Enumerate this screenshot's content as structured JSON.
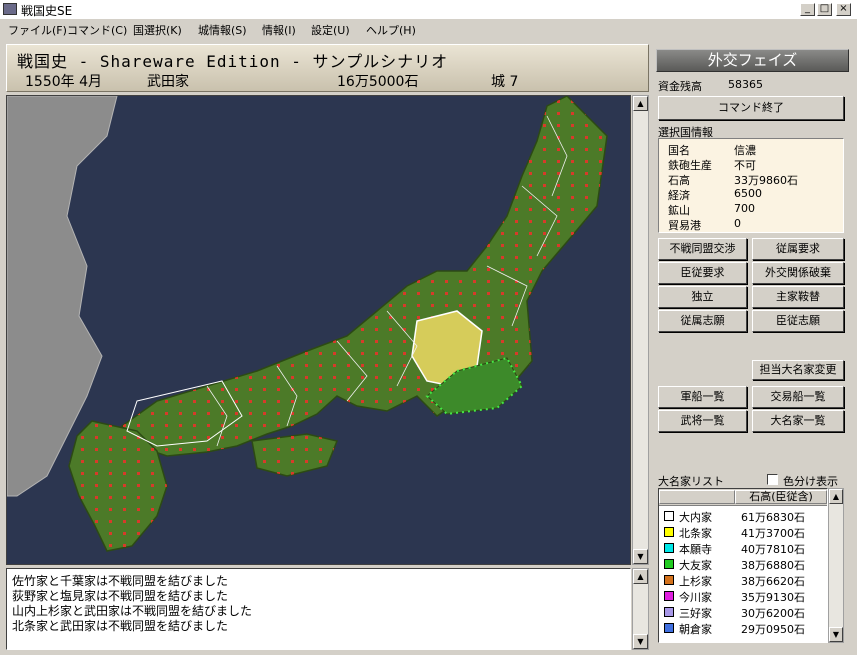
{
  "window": {
    "title": "戦国史SE",
    "minimize": "_",
    "maximize": "□",
    "close": "×"
  },
  "menu": [
    "ファイル(F)",
    "コマンド(C)",
    "国選択(K)",
    "城情報(S)",
    "情報(I)",
    "設定(U)",
    "ヘルプ(H)"
  ],
  "header": {
    "title": "戦国史 - Shareware Edition - サンプルシナリオ",
    "date": "1550年 4月",
    "clan": "武田家",
    "kokudaka": "16万5000石",
    "castles": "城 7"
  },
  "log": [
    "佐竹家と千葉家は不戦同盟を結びました",
    "荻野家と塩見家は不戦同盟を結びました",
    "山内上杉家と武田家は不戦同盟を結びました",
    "北条家と武田家は不戦同盟を結びました"
  ],
  "panel": {
    "phase": "外交フェイズ",
    "funds_label": "資金残高",
    "funds_value": "58365",
    "end_command": "コマンド終了",
    "selected_label": "選択国情報",
    "province": [
      {
        "label": "国名",
        "value": "信濃"
      },
      {
        "label": "鉄砲生産",
        "value": "不可"
      },
      {
        "label": "石高",
        "value": "33万9860石"
      },
      {
        "label": "経済",
        "value": "6500"
      },
      {
        "label": "鉱山",
        "value": "700"
      },
      {
        "label": "貿易港",
        "value": "0"
      }
    ],
    "diplomacy_buttons": [
      "不戦同盟交渉",
      "従属要求",
      "臣従要求",
      "外交関係破棄",
      "独立",
      "主家鞍替",
      "従属志願",
      "臣従志願"
    ],
    "change_daimyo": "担当大名家変更",
    "list_buttons": [
      "軍船一覧",
      "交易船一覧",
      "武将一覧",
      "大名家一覧"
    ],
    "daimyo_list_label": "大名家リスト",
    "color_toggle": "色分け表示",
    "list_column": "石高(臣従含)",
    "daimyo": [
      {
        "name": "大内家",
        "value": "61万6830石",
        "color": "#ffffff"
      },
      {
        "name": "北条家",
        "value": "41万3700石",
        "color": "#ffff00"
      },
      {
        "name": "本願寺",
        "value": "40万7810石",
        "color": "#00e8e8"
      },
      {
        "name": "大友家",
        "value": "38万6880石",
        "color": "#22cc22"
      },
      {
        "name": "上杉家",
        "value": "38万6620石",
        "color": "#d4721c"
      },
      {
        "name": "今川家",
        "value": "35万9130石",
        "color": "#e020e0"
      },
      {
        "name": "三好家",
        "value": "30万6200石",
        "color": "#a898e8"
      },
      {
        "name": "朝倉家",
        "value": "29万0950石",
        "color": "#4070e0"
      }
    ]
  }
}
